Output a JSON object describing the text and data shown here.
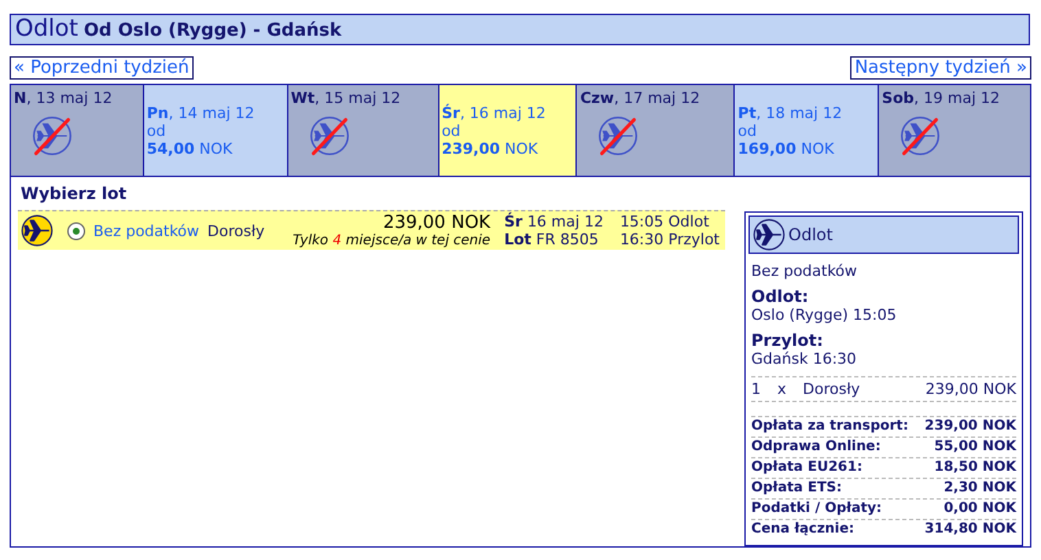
{
  "header": {
    "title": "Odlot",
    "route": "Od Oslo (Rygge) - Gdańsk"
  },
  "nav": {
    "previous": "« Poprzedni tydzień",
    "next": "Następny tydzień »"
  },
  "days": [
    {
      "day": "N",
      "date": ", 13 maj 12",
      "available": false,
      "selected": false
    },
    {
      "day": "Pn",
      "date": ", 14 maj 12",
      "available": true,
      "selected": false,
      "from": "od",
      "price": "54,00",
      "currency": "NOK"
    },
    {
      "day": "Wt",
      "date": ", 15 maj 12",
      "available": false,
      "selected": false
    },
    {
      "day": "Śr",
      "date": ", 16 maj 12",
      "available": true,
      "selected": true,
      "from": "od",
      "price": "239,00",
      "currency": "NOK"
    },
    {
      "day": "Czw",
      "date": ", 17 maj 12",
      "available": false,
      "selected": false
    },
    {
      "day": "Pt",
      "date": ", 18 maj 12",
      "available": true,
      "selected": false,
      "from": "od",
      "price": "169,00",
      "currency": "NOK"
    },
    {
      "day": "Sob",
      "date": ", 19 maj 12",
      "available": false,
      "selected": false
    }
  ],
  "section_title": "Wybierz lot",
  "flight": {
    "selected": true,
    "fare": "Bez podatków",
    "passenger": "Dorosły",
    "price": "239,00 NOK",
    "seats_prefix": "Tylko",
    "seats_count": "4",
    "seats_suffix": "miejsce/a w tej cenie",
    "day_label": "Śr",
    "date": "16 maj 12",
    "flight_label": "Lot",
    "flight_no": "FR 8505",
    "dep_time": "15:05",
    "dep_label": "Odlot",
    "arr_time": "16:30",
    "arr_label": "Przylot"
  },
  "summary": {
    "title": "Odlot",
    "fare": "Bez podatków",
    "departure_label": "Odlot:",
    "departure": "Oslo (Rygge) 15:05",
    "arrival_label": "Przylot:",
    "arrival": "Gdańsk 16:30",
    "passenger_line": {
      "count": "1",
      "times": "x",
      "type": "Dorosły",
      "price": "239,00 NOK"
    },
    "charges": [
      {
        "label": "Opłata za transport:",
        "value": "239,00 NOK"
      },
      {
        "label": "Odprawa Online:",
        "value": "55,00 NOK"
      },
      {
        "label": "Opłata EU261:",
        "value": "18,50 NOK"
      },
      {
        "label": "Opłata ETS:",
        "value": "2,30 NOK"
      },
      {
        "label": "Podatki / Opłaty:",
        "value": "0,00 NOK"
      },
      {
        "label": "Cena łącznie:",
        "value": "314,80 NOK"
      }
    ]
  }
}
